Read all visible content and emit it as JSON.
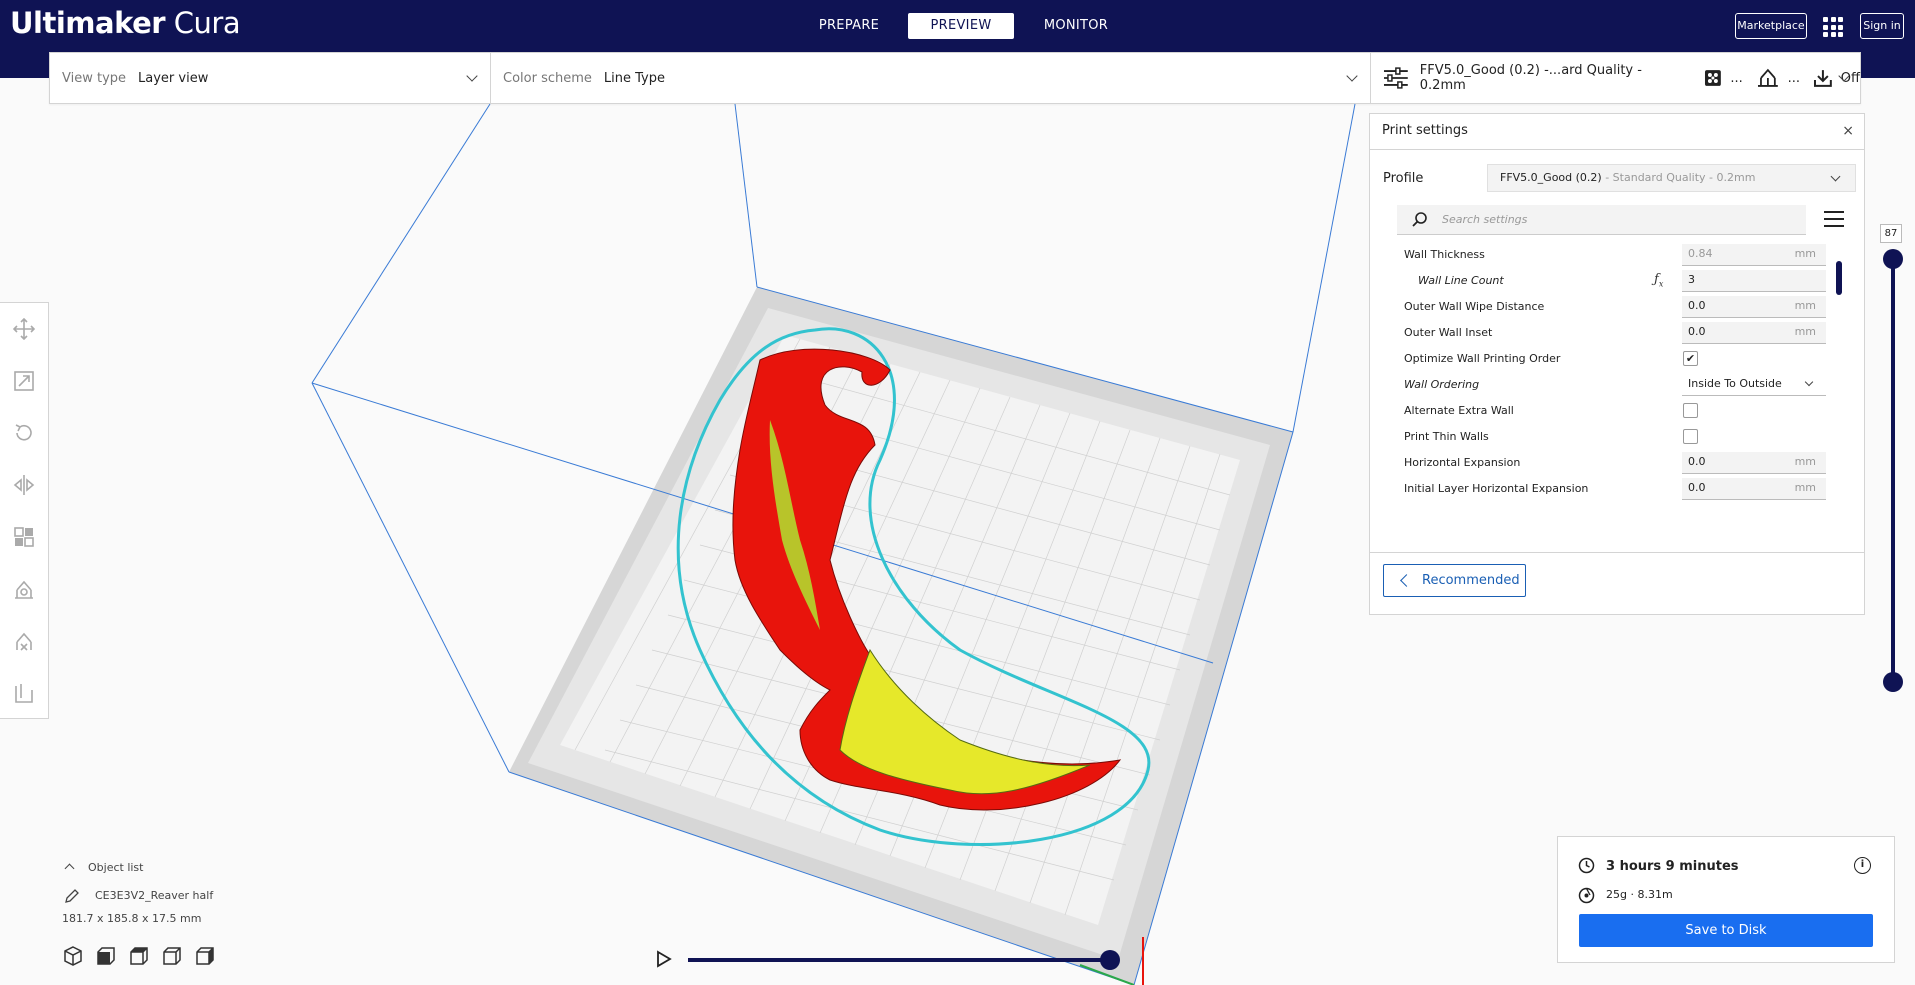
{
  "app": {
    "title_bold": "Ultimaker",
    "title_light": " Cura"
  },
  "stages": {
    "prepare": "PREPARE",
    "preview": "PREVIEW",
    "monitor": "MONITOR"
  },
  "header": {
    "marketplace": "Marketplace",
    "sign_in": "Sign in"
  },
  "toolbar": {
    "view_type_label": "View type",
    "view_type_value": "Layer view",
    "color_scheme_label": "Color scheme",
    "color_scheme_value": "Line Type",
    "print_profile": "FFV5.0_Good (0.2) -...ard Quality - 0.2mm",
    "support_ellipsis": "...",
    "adhesion_ellipsis": "...",
    "adhesion_state": "Off"
  },
  "print_settings": {
    "title": "Print settings",
    "close": "×",
    "profile_label": "Profile",
    "profile_value": "FFV5.0_Good (0.2)",
    "profile_suffix": " - Standard Quality - 0.2mm",
    "search_placeholder": "Search settings",
    "settings": [
      {
        "label": "Wall Thickness",
        "value": "0.84",
        "unit": "mm"
      },
      {
        "label": "Wall Line Count",
        "value": "3"
      },
      {
        "label": "Outer Wall Wipe Distance",
        "value": "0.0",
        "unit": "mm"
      },
      {
        "label": "Outer Wall Inset",
        "value": "0.0",
        "unit": "mm"
      },
      {
        "label": "Optimize Wall Printing Order",
        "checked": "✔"
      },
      {
        "label": "Wall Ordering",
        "value": "Inside To Outside"
      },
      {
        "label": "Alternate Extra Wall",
        "checked": ""
      },
      {
        "label": "Print Thin Walls",
        "checked": ""
      },
      {
        "label": "Horizontal Expansion",
        "value": "0.0",
        "unit": "mm"
      },
      {
        "label": "Initial Layer Horizontal Expansion",
        "value": "0.0",
        "unit": "mm"
      }
    ],
    "recommended_button": "Recommended"
  },
  "layer_slider": {
    "current_layer": "87"
  },
  "object_list": {
    "header": "Object list",
    "object_name": "CE3E3V2_Reaver half",
    "dimensions": "181.7 x 185.8 x 17.5 mm"
  },
  "output": {
    "print_time": "3 hours 9 minutes",
    "material": "25g · 8.31m",
    "info": "i",
    "save_button": "Save to Disk"
  },
  "colors": {
    "header_bg": "#0f1354",
    "accent_blue": "#196ef0",
    "model_red": "#e8140c",
    "model_yellow": "#e6e82a",
    "skirt_cyan": "#33c3cf"
  }
}
